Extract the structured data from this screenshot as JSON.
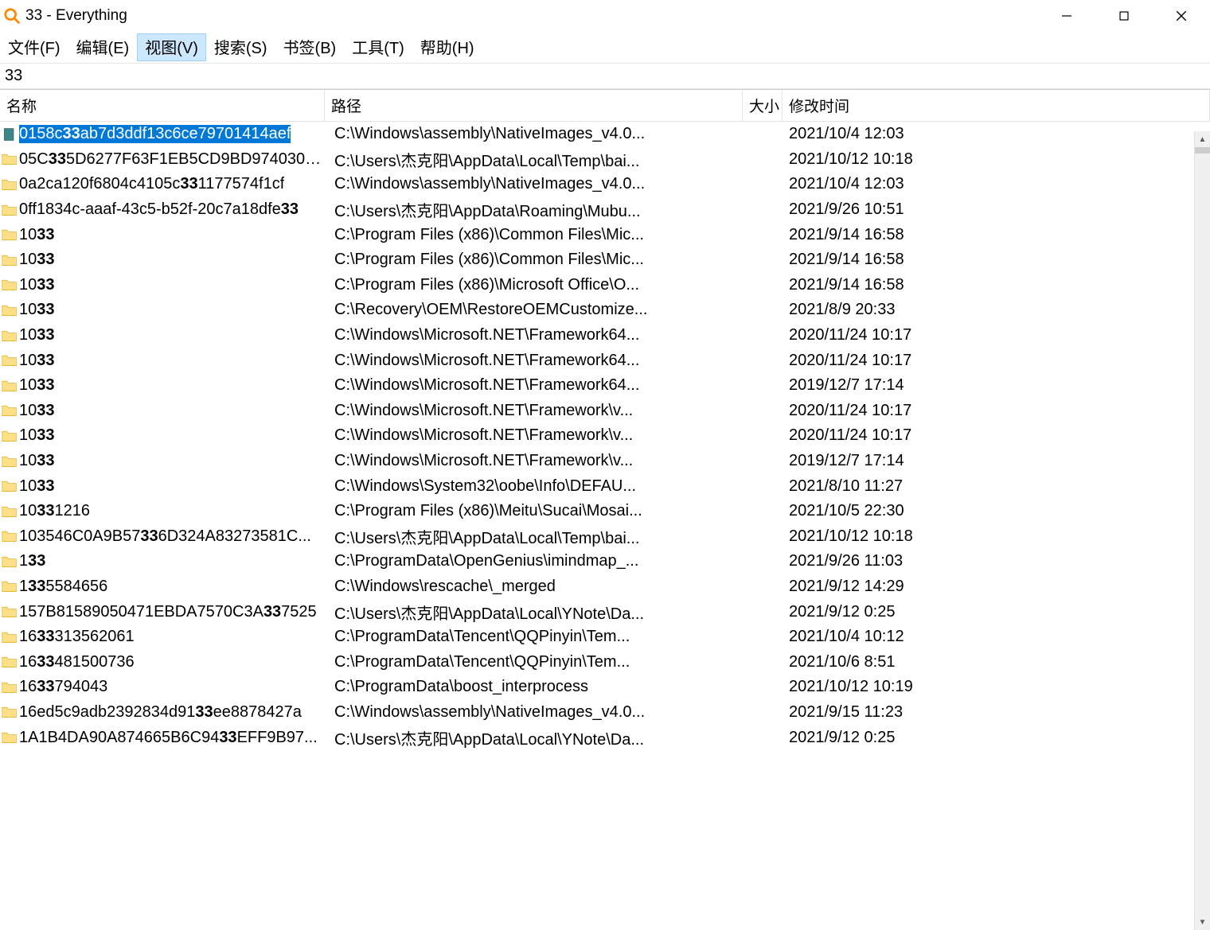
{
  "window": {
    "title": "33 - Everything"
  },
  "menu": {
    "file": "文件(F)",
    "edit": "编辑(E)",
    "view": "视图(V)",
    "search": "搜索(S)",
    "bookmark": "书签(B)",
    "tool": "工具(T)",
    "help": "帮助(H)"
  },
  "search_value": "33",
  "columns": {
    "name": "名称",
    "path": "路径",
    "size": "大小",
    "modified": "修改时间"
  },
  "highlight_term": "33",
  "rows": [
    {
      "icon": "file",
      "name": "0158c33ab7d3ddf13c6ce79701414aef",
      "path": "C:\\Windows\\assembly\\NativeImages_v4.0...",
      "size": "",
      "modified": "2021/10/4 12:03",
      "selected": true
    },
    {
      "icon": "folder",
      "name": "05C335D6277F63F1EB5CD9BD9740300...",
      "path": "C:\\Users\\杰克阳\\AppData\\Local\\Temp\\bai...",
      "size": "",
      "modified": "2021/10/12 10:18"
    },
    {
      "icon": "folder",
      "name": "0a2ca120f6804c4105c331177574f1cf",
      "path": "C:\\Windows\\assembly\\NativeImages_v4.0...",
      "size": "",
      "modified": "2021/10/4 12:03"
    },
    {
      "icon": "folder",
      "name": "0ff1834c-aaaf-43c5-b52f-20c7a18dfe33",
      "path": "C:\\Users\\杰克阳\\AppData\\Roaming\\Mubu...",
      "size": "",
      "modified": "2021/9/26 10:51"
    },
    {
      "icon": "folder",
      "name": "1033",
      "path": "C:\\Program Files (x86)\\Common Files\\Mic...",
      "size": "",
      "modified": "2021/9/14 16:58"
    },
    {
      "icon": "folder",
      "name": "1033",
      "path": "C:\\Program Files (x86)\\Common Files\\Mic...",
      "size": "",
      "modified": "2021/9/14 16:58"
    },
    {
      "icon": "folder",
      "name": "1033",
      "path": "C:\\Program Files (x86)\\Microsoft Office\\O...",
      "size": "",
      "modified": "2021/9/14 16:58"
    },
    {
      "icon": "folder",
      "name": "1033",
      "path": "C:\\Recovery\\OEM\\RestoreOEMCustomize...",
      "size": "",
      "modified": "2021/8/9 20:33"
    },
    {
      "icon": "folder",
      "name": "1033",
      "path": "C:\\Windows\\Microsoft.NET\\Framework64...",
      "size": "",
      "modified": "2020/11/24 10:17"
    },
    {
      "icon": "folder",
      "name": "1033",
      "path": "C:\\Windows\\Microsoft.NET\\Framework64...",
      "size": "",
      "modified": "2020/11/24 10:17"
    },
    {
      "icon": "folder",
      "name": "1033",
      "path": "C:\\Windows\\Microsoft.NET\\Framework64...",
      "size": "",
      "modified": "2019/12/7 17:14"
    },
    {
      "icon": "folder",
      "name": "1033",
      "path": "C:\\Windows\\Microsoft.NET\\Framework\\v...",
      "size": "",
      "modified": "2020/11/24 10:17"
    },
    {
      "icon": "folder",
      "name": "1033",
      "path": "C:\\Windows\\Microsoft.NET\\Framework\\v...",
      "size": "",
      "modified": "2020/11/24 10:17"
    },
    {
      "icon": "folder",
      "name": "1033",
      "path": "C:\\Windows\\Microsoft.NET\\Framework\\v...",
      "size": "",
      "modified": "2019/12/7 17:14"
    },
    {
      "icon": "folder",
      "name": "1033",
      "path": "C:\\Windows\\System32\\oobe\\Info\\DEFAU...",
      "size": "",
      "modified": "2021/8/10 11:27"
    },
    {
      "icon": "folder",
      "name": "10331216",
      "path": "C:\\Program Files (x86)\\Meitu\\Sucai\\Mosai...",
      "size": "",
      "modified": "2021/10/5 22:30"
    },
    {
      "icon": "folder",
      "name": "103546C0A9B57336D324A83273581C...",
      "path": "C:\\Users\\杰克阳\\AppData\\Local\\Temp\\bai...",
      "size": "",
      "modified": "2021/10/12 10:18"
    },
    {
      "icon": "folder",
      "name": "133",
      "path": "C:\\ProgramData\\OpenGenius\\imindmap_...",
      "size": "",
      "modified": "2021/9/26 11:03"
    },
    {
      "icon": "folder",
      "name": "1335584656",
      "path": "C:\\Windows\\rescache\\_merged",
      "size": "",
      "modified": "2021/9/12 14:29"
    },
    {
      "icon": "folder",
      "name": "157B81589050471EBDA7570C3A337525",
      "path": "C:\\Users\\杰克阳\\AppData\\Local\\YNote\\Da...",
      "size": "",
      "modified": "2021/9/12 0:25"
    },
    {
      "icon": "folder",
      "name": "1633313562061",
      "path": "C:\\ProgramData\\Tencent\\QQPinyin\\Tem...",
      "size": "",
      "modified": "2021/10/4 10:12"
    },
    {
      "icon": "folder",
      "name": "1633481500736",
      "path": "C:\\ProgramData\\Tencent\\QQPinyin\\Tem...",
      "size": "",
      "modified": "2021/10/6 8:51"
    },
    {
      "icon": "folder",
      "name": "1633794043",
      "path": "C:\\ProgramData\\boost_interprocess",
      "size": "",
      "modified": "2021/10/12 10:19"
    },
    {
      "icon": "folder",
      "name": "16ed5c9adb2392834d9133ee8878427a",
      "path": "C:\\Windows\\assembly\\NativeImages_v4.0...",
      "size": "",
      "modified": "2021/9/15 11:23"
    },
    {
      "icon": "folder",
      "name": "1A1B4DA90A874665B6C9433EFF9B97...",
      "path": "C:\\Users\\杰克阳\\AppData\\Local\\YNote\\Da...",
      "size": "",
      "modified": "2021/9/12 0:25"
    }
  ]
}
